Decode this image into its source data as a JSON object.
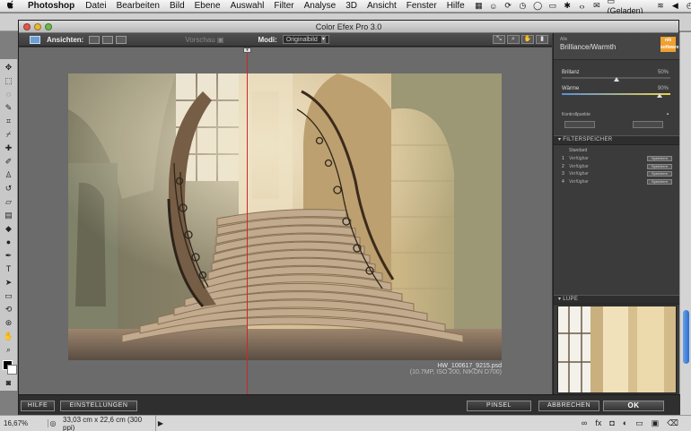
{
  "menubar": {
    "apple": "",
    "app": "Photoshop",
    "items": [
      "Datei",
      "Bearbeiten",
      "Bild",
      "Ebene",
      "Auswahl",
      "Filter",
      "Analyse",
      "3D",
      "Ansicht",
      "Fenster",
      "Hilfe"
    ],
    "battery": "(Geladen)"
  },
  "window": {
    "title": "Color Efex Pro 3.0"
  },
  "toolbar": {
    "views_label": "Ansichten:",
    "vorschau_label": "Vorschau",
    "modi_label": "Modi:",
    "modi_value": "Originalbild"
  },
  "image": {
    "filename": "HW_100617_9215.psd",
    "meta": "(10.7MP, ISO 200, NIKON D700)"
  },
  "panel": {
    "category": "Alle",
    "filter_name": "Brilliance/Warmth",
    "logo": "nik software",
    "sliders": [
      {
        "name": "Brillanz",
        "value": "50%",
        "level": 0.5
      },
      {
        "name": "Wärme",
        "value": "90%",
        "level": 0.9
      }
    ],
    "kontrollpunkte_label": "Kontrollpunkte",
    "filterspeicher_title": "FILTERSPEICHER",
    "standard_label": "Standard",
    "slots": [
      {
        "num": "1",
        "label": "Verfügbar",
        "save": "Speichern"
      },
      {
        "num": "2",
        "label": "Verfügbar",
        "save": "Speichern"
      },
      {
        "num": "3",
        "label": "Verfügbar",
        "save": "Speichern"
      },
      {
        "num": "4",
        "label": "Verfügbar",
        "save": "Speichern"
      }
    ],
    "lupe_title": "LUPE"
  },
  "buttons": {
    "hilfe": "HILFE",
    "einstellungen": "EINSTELLUNGEN",
    "pinsel": "PINSEL",
    "abbrechen": "ABBRECHEN",
    "ok": "OK"
  },
  "statusbar": {
    "zoom": "16,67%",
    "docsize": "33,03 cm x 22,6 cm (300 ppi)"
  },
  "ruler": "1"
}
